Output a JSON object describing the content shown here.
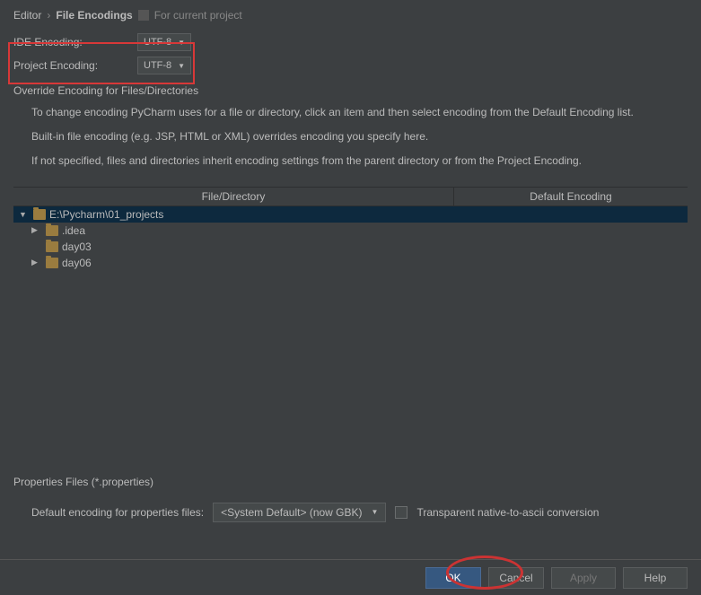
{
  "breadcrumb": {
    "parent": "Editor",
    "current": "File Encodings",
    "scope": "For current project"
  },
  "ide_encoding": {
    "label": "IDE Encoding:",
    "value": "UTF-8"
  },
  "project_encoding": {
    "label": "Project Encoding:",
    "value": "UTF-8"
  },
  "override_title": "Override Encoding for Files/Directories",
  "desc": {
    "p1": "To change encoding PyCharm uses for a file or directory, click an item and then select encoding from the Default Encoding list.",
    "p2": "Built-in file encoding (e.g. JSP, HTML or XML) overrides encoding you specify here.",
    "p3": "If not specified, files and directories inherit encoding settings from the parent directory or from the Project Encoding."
  },
  "columns": {
    "c1": "File/Directory",
    "c2": "Default Encoding"
  },
  "tree": {
    "root": "E:\\Pycharm\\01_projects",
    "child1": ".idea",
    "child2": "day03",
    "child3": "day06"
  },
  "props": {
    "title": "Properties Files (*.properties)",
    "label": "Default encoding for properties files:",
    "value": "<System Default> (now GBK)",
    "checkbox_label": "Transparent native-to-ascii conversion"
  },
  "buttons": {
    "ok": "OK",
    "cancel": "Cancel",
    "apply": "Apply",
    "help": "Help"
  }
}
